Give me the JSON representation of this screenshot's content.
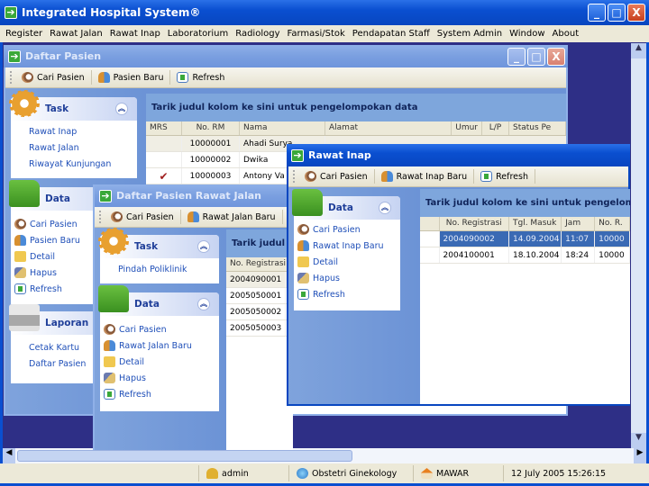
{
  "app": {
    "title": "Integrated Hospital System®"
  },
  "menu": [
    "Register",
    "Rawat Jalan",
    "Rawat Inap",
    "Laboratorium",
    "Radiology",
    "Farmasi/Stok",
    "Pendapatan Staff",
    "System Admin",
    "Window",
    "About"
  ],
  "window_buttons": {
    "minimize": "_",
    "maximize": "□",
    "close": "X"
  },
  "daftar_pasien": {
    "title": "Daftar Pasien",
    "toolbar": [
      "Cari Pasien",
      "Pasien Baru",
      "Refresh"
    ],
    "task": {
      "title": "Task",
      "items": [
        "Rawat Inap",
        "Rawat Jalan",
        "Riwayat Kunjungan"
      ]
    },
    "data": {
      "title": "Data",
      "items": [
        "Cari Pasien",
        "Pasien Baru",
        "Detail",
        "Hapus",
        "Refresh"
      ]
    },
    "laporan": {
      "title": "Laporan",
      "items": [
        "Cetak Kartu",
        "Daftar Pasien"
      ]
    },
    "group_hint": "Tarik judul kolom ke sini untuk pengelompokan data",
    "columns": [
      "MRS",
      "No. RM",
      "Nama",
      "Alamat",
      "Umur",
      "L/P",
      "Status Pe"
    ],
    "rows": [
      {
        "mrs": "",
        "no_rm": "10000001",
        "nama": "Ahadi Surya"
      },
      {
        "mrs": "",
        "no_rm": "10000002",
        "nama": "Dwika"
      },
      {
        "mrs": "✔",
        "no_rm": "10000003",
        "nama": "Antony Va"
      }
    ]
  },
  "rawat_jalan": {
    "title": "Daftar Pasien Rawat Jalan",
    "toolbar": [
      "Cari Pasien",
      "Rawat Jalan Baru"
    ],
    "task": {
      "title": "Task",
      "items": [
        "Pindah Poliklinik"
      ]
    },
    "data": {
      "title": "Data",
      "items": [
        "Cari Pasien",
        "Rawat Jalan Baru",
        "Detail",
        "Hapus",
        "Refresh"
      ]
    },
    "group_hint": "Tarik judul k",
    "columns": [
      "No. Registrasi"
    ],
    "rows": [
      "2004090001",
      "2005050001",
      "2005050002",
      "2005050003"
    ]
  },
  "rawat_inap": {
    "title": "Rawat Inap",
    "toolbar": [
      "Cari Pasien",
      "Rawat Inap Baru",
      "Refresh"
    ],
    "data": {
      "title": "Data",
      "items": [
        "Cari Pasien",
        "Rawat Inap Baru",
        "Detail",
        "Hapus",
        "Refresh"
      ]
    },
    "group_hint": "Tarik judul kolom ke sini untuk pengelompo",
    "columns": [
      "No. Registrasi",
      "Tgl. Masuk",
      "Jam",
      "No. R."
    ],
    "rows": [
      {
        "no_reg": "2004090002",
        "tgl": "14.09.2004",
        "jam": "11:07",
        "no_r": "10000",
        "selected": true
      },
      {
        "no_reg": "2004100001",
        "tgl": "18.10.2004",
        "jam": "18:24",
        "no_r": "10000",
        "selected": false
      }
    ]
  },
  "status": {
    "user": "admin",
    "department": "Obstetri Ginekology",
    "room": "MAWAR",
    "datetime": "12 July 2005 15:26:15"
  },
  "colors": {
    "mdi_background": "#2e2f86",
    "titlebar": "#0a4fd0",
    "selection": "#3a6ab4"
  }
}
